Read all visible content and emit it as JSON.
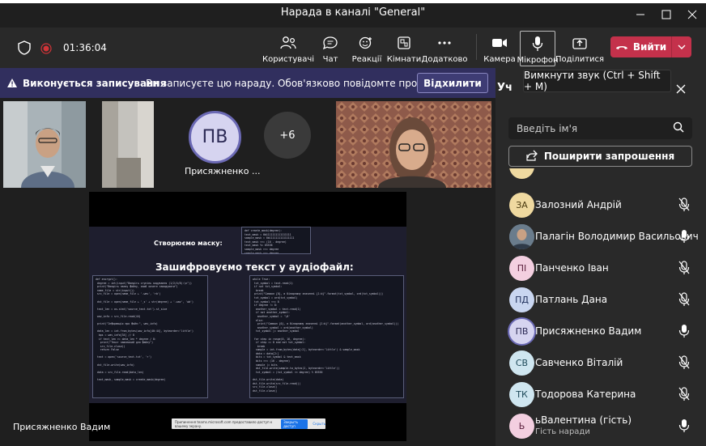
{
  "window": {
    "title": "Нарада в каналі \"General\""
  },
  "toolbar": {
    "timer": "01:36:04",
    "items": [
      {
        "label": "Користувачі",
        "icon": "people-icon"
      },
      {
        "label": "Чат",
        "icon": "chat-icon"
      },
      {
        "label": "Реакції",
        "icon": "reactions-icon"
      },
      {
        "label": "Кімнати",
        "icon": "rooms-icon"
      },
      {
        "label": "Додатково",
        "icon": "more-icon"
      },
      {
        "label": "Камера",
        "icon": "camera-icon"
      },
      {
        "label": "Мікрофон",
        "icon": "microphone-icon"
      },
      {
        "label": "Поділитися",
        "icon": "share-icon"
      }
    ],
    "leave_label": "Вийти"
  },
  "banner": {
    "title": "Виконується записування",
    "text": "Ви записуєте цю нараду. Обов'язково повідомте про запис...",
    "dismiss": "Відхилити"
  },
  "tiles": {
    "avatar_initials": "ПВ",
    "avatar_name": "Присяжненко ...",
    "more_count": "+6"
  },
  "share": {
    "presenter": "Присяжненко Вадим",
    "slide_heading_mask": "Створюємо маску:",
    "slide_heading_main": "Зашифровуємо текст у аудіофайл:",
    "infobar_text": "Припинення teams.microsoft.com предоставило доступ к вашему экрану.",
    "infobar_stop": "Закрыть доступ",
    "infobar_hide": "Скрыть"
  },
  "panel": {
    "header": "Уч",
    "tooltip": "Вимкнути звук (Ctrl + Shift + M)",
    "search_placeholder": "Введіть ім'я",
    "share_invite": "Поширити запрошення",
    "people": [
      {
        "initials": "ЗА",
        "name": "Залозний Андрій",
        "color": "#efd9a0",
        "text": "#4a3a10",
        "mic": "muted"
      },
      {
        "initials": "",
        "name": "Палагін Володимир Васильович",
        "color": "#6a7c8c",
        "text": "#fff",
        "mic": "on",
        "photo": true
      },
      {
        "initials": "ПІ",
        "name": "Панченко Іван",
        "color": "#f3cfe0",
        "text": "#5a1f3c",
        "mic": "muted"
      },
      {
        "initials": "ПД",
        "name": "Патлань Дана",
        "color": "#c9d6f0",
        "text": "#1f2f5a",
        "mic": "muted"
      },
      {
        "initials": "ПВ",
        "name": "Присяжненко Вадим",
        "color": "#d6d4f0",
        "text": "#2c2a55",
        "mic": "on",
        "ring": true
      },
      {
        "initials": "СВ",
        "name": "Савченко Віталій",
        "color": "#cfe6f0",
        "text": "#1f4a5a",
        "mic": "muted"
      },
      {
        "initials": "ТК",
        "name": "Тодорова Катерина",
        "color": "#cfe6f0",
        "text": "#1f4a5a",
        "mic": "muted"
      },
      {
        "initials": "Ь",
        "name": "ьВалентина (гість)",
        "sub": "Гість наради",
        "color": "#f3cfe0",
        "text": "#5a1f3c",
        "mic": "on"
      }
    ]
  }
}
